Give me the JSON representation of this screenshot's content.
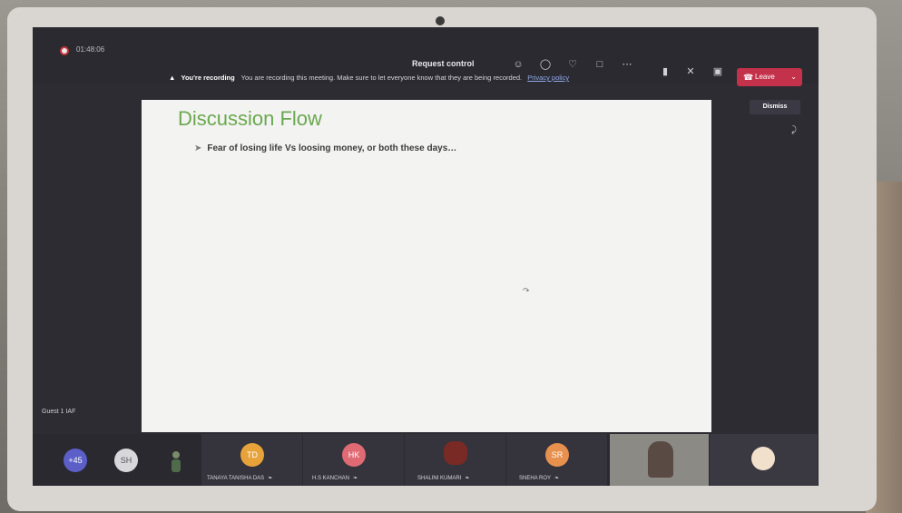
{
  "window": {
    "timer": "01:48:06",
    "request_control_label": "Request control"
  },
  "toolbar": {
    "icons": [
      "people-icon",
      "chat-icon",
      "reactions-icon",
      "share-icon",
      "more-icon",
      "camera-icon",
      "mic-muted-icon",
      "share-tray-icon"
    ],
    "leave_label": "Leave",
    "leave_color": "#c4314b"
  },
  "recording_banner": {
    "title": "You're recording",
    "message": "You are recording this meeting. Make sure to let everyone know that they are being recorded.",
    "privacy_link": "Privacy policy",
    "dismiss_label": "Dismiss"
  },
  "slide": {
    "title": "Discussion Flow",
    "title_color": "#6aa84f",
    "bullet": "Fear of losing life Vs loosing money, or both these days…"
  },
  "guest_label": "Guest 1 IAF",
  "participants": {
    "more_count": "+45",
    "sh_initials": "SH",
    "tiles": [
      {
        "initials": "TD",
        "name": "TANAYA TANISHA DAS"
      },
      {
        "initials": "HK",
        "name": "H.S KANCHAN"
      },
      {
        "initials": "",
        "name": "SHALINI KUMARI"
      },
      {
        "initials": "SR",
        "name": "SNEHA ROY"
      }
    ]
  }
}
